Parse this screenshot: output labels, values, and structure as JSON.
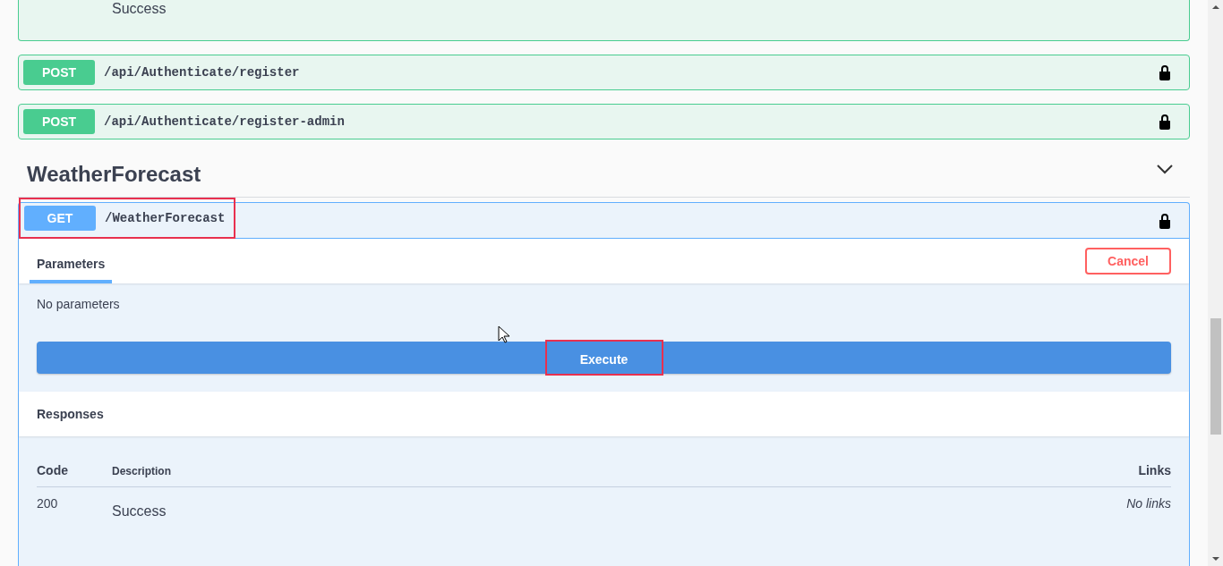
{
  "previous_operation": {
    "response_description": "Success"
  },
  "operations": [
    {
      "method": "POST",
      "path": "/api/Authenticate/register",
      "locked": true
    },
    {
      "method": "POST",
      "path": "/api/Authenticate/register-admin",
      "locked": true
    }
  ],
  "tag_section": {
    "title": "WeatherForecast",
    "expanded": true
  },
  "open_operation": {
    "method": "GET",
    "path": "/WeatherForecast",
    "locked": true,
    "highlighted": true,
    "tabs": [
      {
        "label": "Parameters",
        "selected": true
      }
    ],
    "cancel_button": "Cancel",
    "no_params_text": "No parameters",
    "execute_button": {
      "label": "Execute",
      "highlighted": true
    },
    "responses_title": "Responses",
    "responses_table": {
      "columns": [
        "Code",
        "Description",
        "Links"
      ],
      "rows": [
        {
          "code": "200",
          "description": "Success",
          "links": "No links"
        }
      ]
    }
  }
}
